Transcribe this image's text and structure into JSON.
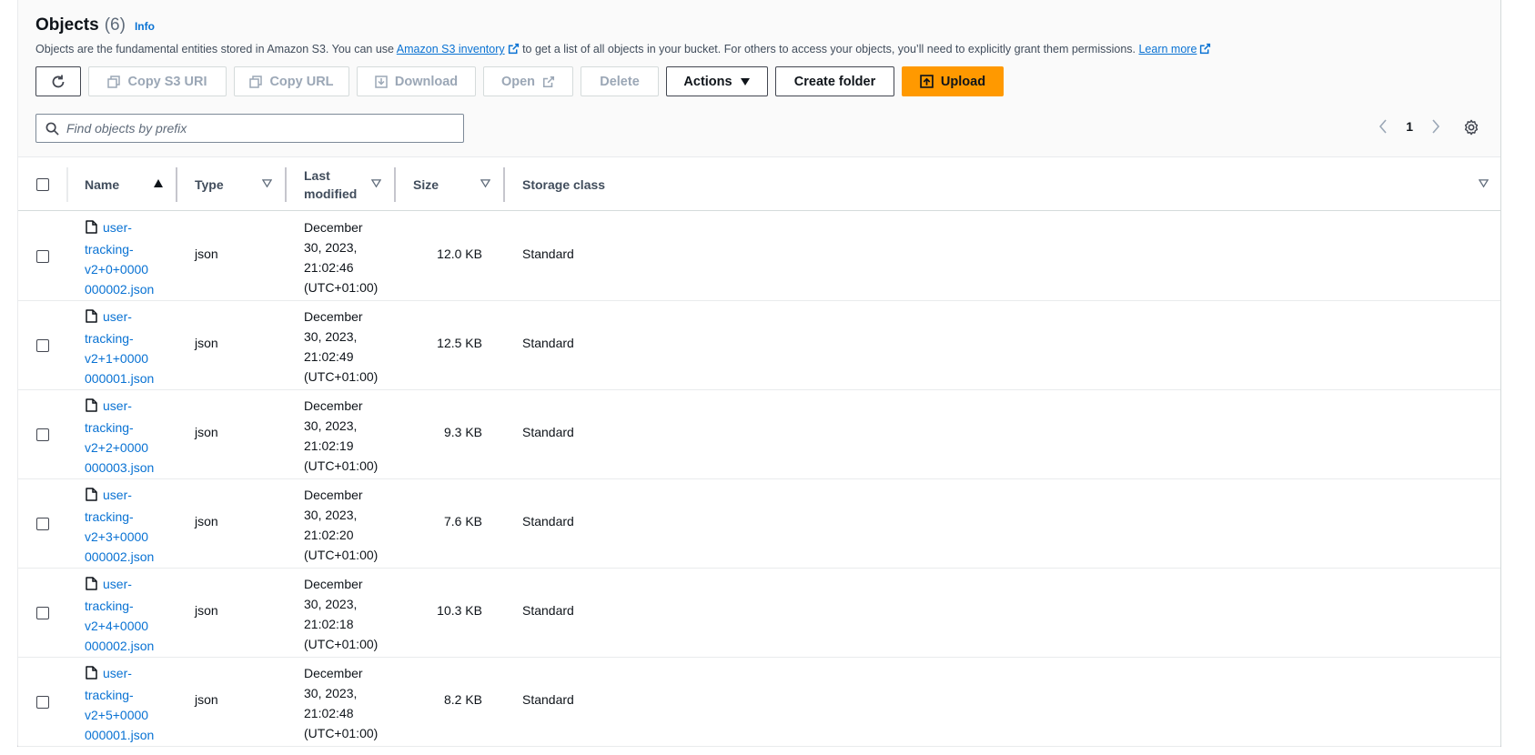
{
  "header": {
    "title": "Objects",
    "count": "(6)",
    "info": "Info",
    "description_pre": "Objects are the fundamental entities stored in Amazon S3. You can use ",
    "inventory_link": "Amazon S3 inventory",
    "description_mid": " to get a list of all objects in your bucket. For others to access your objects, you’ll need to explicitly grant them permissions. ",
    "learn_more": "Learn more"
  },
  "toolbar": {
    "copy_s3_uri": "Copy S3 URI",
    "copy_url": "Copy URL",
    "download": "Download",
    "open": "Open",
    "delete": "Delete",
    "actions": "Actions",
    "create_folder": "Create folder",
    "upload": "Upload"
  },
  "search": {
    "placeholder": "Find objects by prefix"
  },
  "pagination": {
    "current_page": "1"
  },
  "table": {
    "columns": {
      "name": "Name",
      "type": "Type",
      "last_modified_1": "Last",
      "last_modified_2": "modified",
      "size": "Size",
      "storage_class": "Storage class"
    },
    "rows": [
      {
        "name_lines": [
          "user-",
          "tracking-",
          "v2+0+0000",
          "000002.json"
        ],
        "type": "json",
        "date_lines": [
          "December",
          "30, 2023,",
          "21:02:46",
          "(UTC+01:00)"
        ],
        "size": "12.0 KB",
        "storage_class": "Standard"
      },
      {
        "name_lines": [
          "user-",
          "tracking-",
          "v2+1+0000",
          "000001.json"
        ],
        "type": "json",
        "date_lines": [
          "December",
          "30, 2023,",
          "21:02:49",
          "(UTC+01:00)"
        ],
        "size": "12.5 KB",
        "storage_class": "Standard"
      },
      {
        "name_lines": [
          "user-",
          "tracking-",
          "v2+2+0000",
          "000003.json"
        ],
        "type": "json",
        "date_lines": [
          "December",
          "30, 2023,",
          "21:02:19",
          "(UTC+01:00)"
        ],
        "size": "9.3 KB",
        "storage_class": "Standard"
      },
      {
        "name_lines": [
          "user-",
          "tracking-",
          "v2+3+0000",
          "000002.json"
        ],
        "type": "json",
        "date_lines": [
          "December",
          "30, 2023,",
          "21:02:20",
          "(UTC+01:00)"
        ],
        "size": "7.6 KB",
        "storage_class": "Standard"
      },
      {
        "name_lines": [
          "user-",
          "tracking-",
          "v2+4+0000",
          "000002.json"
        ],
        "type": "json",
        "date_lines": [
          "December",
          "30, 2023,",
          "21:02:18",
          "(UTC+01:00)"
        ],
        "size": "10.3 KB",
        "storage_class": "Standard"
      },
      {
        "name_lines": [
          "user-",
          "tracking-",
          "v2+5+0000",
          "000001.json"
        ],
        "type": "json",
        "date_lines": [
          "December",
          "30, 2023,",
          "21:02:48",
          "(UTC+01:00)"
        ],
        "size": "8.2 KB",
        "storage_class": "Standard"
      }
    ]
  },
  "colors": {
    "link": "#0972d3",
    "upload_bg": "#ff9900",
    "disabled_text": "#9ba7b6",
    "header_bg": "#fafafa"
  },
  "icons": {
    "refresh": "refresh-icon",
    "copy": "copy-icon",
    "download": "download-icon",
    "external": "external-link-icon",
    "caret": "caret-down-icon",
    "upload": "upload-icon",
    "search": "search-icon",
    "file": "file-icon",
    "settings": "gear-icon"
  }
}
